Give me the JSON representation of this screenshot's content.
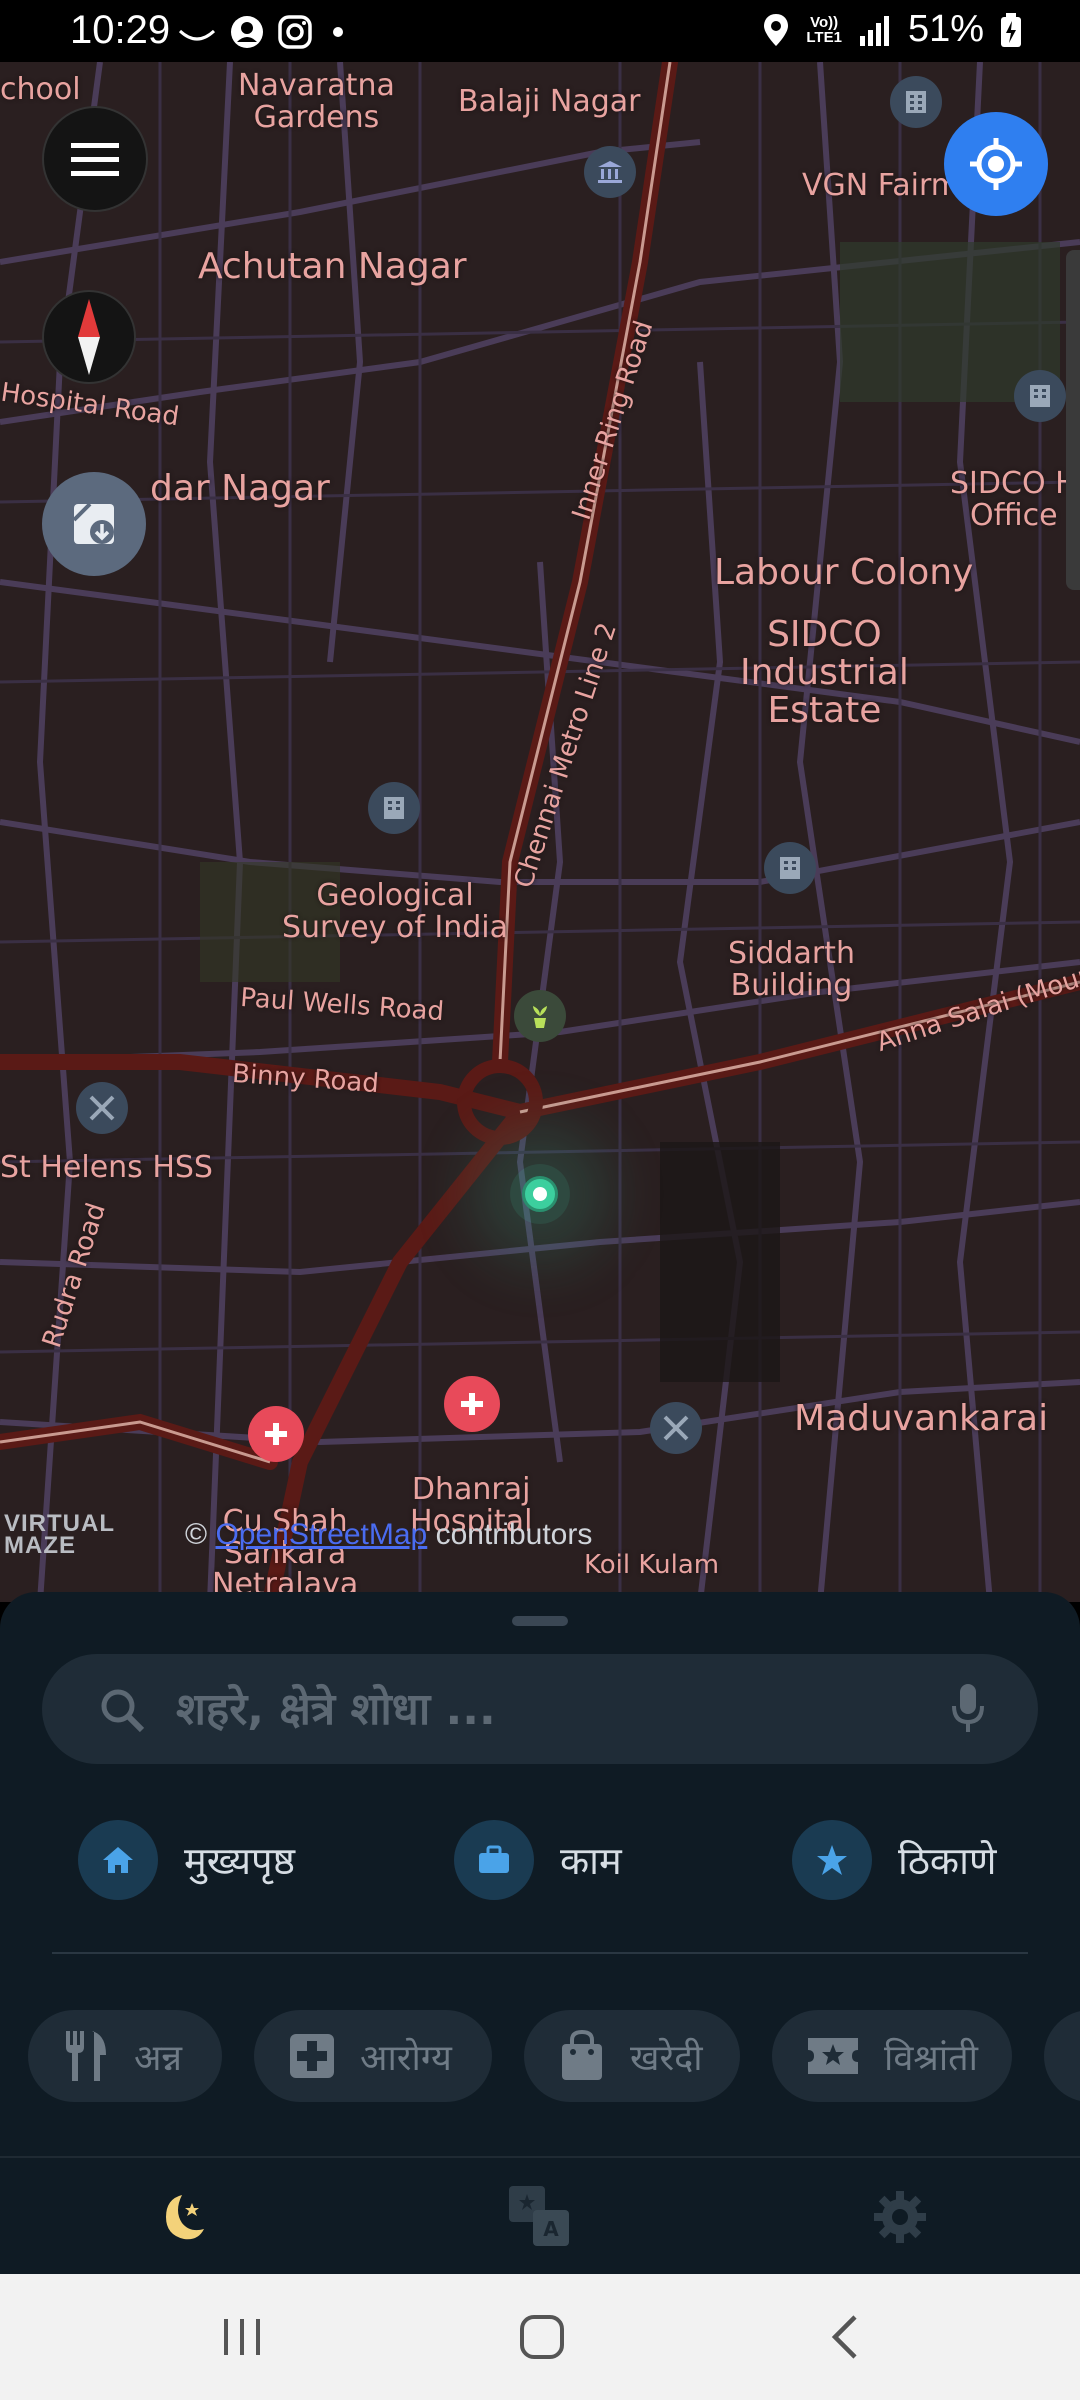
{
  "status_bar": {
    "time": "10:29",
    "battery": "51%",
    "icons": [
      "missed-call-icon",
      "account-icon",
      "instagram-icon",
      "dot-icon",
      "location-icon",
      "volte-lte-icon",
      "signal-icon",
      "battery-charging-icon"
    ],
    "network_label_top": "Vo))",
    "network_label_bottom": "LTE1"
  },
  "map": {
    "labels": {
      "school": "chool",
      "navaratna": "Navaratna\nGardens",
      "balaji": "Balaji Nagar",
      "vgn": "VGN Fairm",
      "achutan": "Achutan Nagar",
      "hospital_road": "Hospital Road",
      "dar_nagar": "dar Nagar",
      "inner_ring": "Inner Ring Road",
      "sidco_office": "SIDCO H\nOffice",
      "labour": "Labour Colony",
      "sidco_estate": "SIDCO\nIndustrial\nEstate",
      "metro": "Chennai Metro Line 2",
      "geological": "Geological\nSurvey of India",
      "siddarth": "Siddarth\nBuilding",
      "paul_wells": "Paul Wells Road",
      "anna_salai": "Anna Salai (Mount",
      "binny": "Binny Road",
      "st_helens": "St Helens HSS",
      "rudra": "Rudra Road",
      "maduvankarai": "Maduvankarai",
      "dhanraj": "Dhanraj\nHospital",
      "cu_shah": "Cu Shah\nSankara\nNetralaya",
      "koil": "Koil Kulam"
    },
    "attribution_logo": "VIRTUAL\nMAZE",
    "attribution_prefix": "© ",
    "attribution_link": "OpenStreetMap",
    "attribution_suffix": " contributors"
  },
  "controls": {
    "menu_icon": "hamburger-menu-icon",
    "compass_icon": "compass-icon",
    "download_icon": "map-download-icon",
    "locate_icon": "my-location-icon"
  },
  "sheet": {
    "search_placeholder": "शहरे, क्षेत्रे शोधा ...",
    "quick_links": [
      {
        "label": "मुख्यपृष्ठ",
        "icon": "home-icon"
      },
      {
        "label": "काम",
        "icon": "briefcase-icon"
      },
      {
        "label": "ठिकाणे",
        "icon": "star-icon"
      }
    ],
    "categories": [
      {
        "label": "अन्न",
        "icon": "fork-knife-icon"
      },
      {
        "label": "आरोग्य",
        "icon": "medical-cross-icon"
      },
      {
        "label": "खरेदी",
        "icon": "shopping-bag-icon"
      },
      {
        "label": "विश्रांती",
        "icon": "ticket-star-icon"
      }
    ]
  },
  "bottom_nav": {
    "items": [
      "night-mode-icon",
      "translate-icon",
      "settings-icon"
    ]
  },
  "colors": {
    "accent": "#2f7ff0",
    "sheet_bg": "#0f1b24",
    "map_bg": "#2a1f20",
    "map_label": "#e8a3a0",
    "road": "#5c4a6a",
    "main_road": "#5a1a16",
    "poi_red": "#e84a5a",
    "moon": "#f3d27a"
  }
}
